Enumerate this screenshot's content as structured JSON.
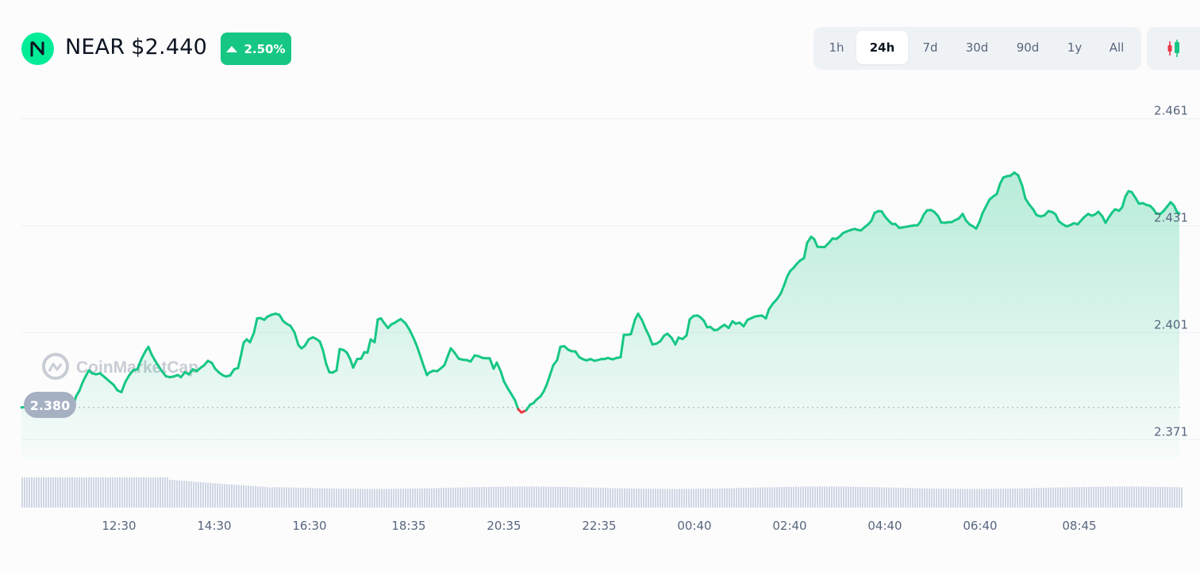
{
  "header": {
    "symbol": "NEAR",
    "price": "$2.440",
    "change": "2.50%",
    "change_direction": "up",
    "logo_icon": "near-logo-icon",
    "colors": {
      "up": "#16c784",
      "down": "#ea3943",
      "logo_bg": "#00ec97"
    }
  },
  "range_tabs": {
    "items": [
      "1h",
      "24h",
      "7d",
      "30d",
      "90d",
      "1y",
      "All"
    ],
    "active": "24h"
  },
  "candlestick_toggle": {
    "icon": "candlestick-icon"
  },
  "watermark": "CoinMarketCap",
  "chart_data": {
    "type": "area",
    "title": "",
    "xlabel": "",
    "ylabel": "",
    "reference_price": 2.38,
    "reference_label": "2.380",
    "ylim": [
      2.3655,
      2.4625
    ],
    "y_ticks": [
      "2.461",
      "2.431",
      "2.401",
      "2.371"
    ],
    "x_ticks": [
      "12:30",
      "14:30",
      "16:30",
      "18:35",
      "20:35",
      "22:35",
      "00:40",
      "02:40",
      "04:40",
      "06:40",
      "08:45"
    ],
    "xlim": [
      0,
      1464
    ],
    "x": [
      0,
      120,
      240,
      365,
      485,
      605,
      725,
      845,
      965,
      1085,
      1210
    ],
    "series_points": [
      [
        0,
        2.38
      ],
      [
        7,
        2.3802
      ],
      [
        12,
        2.3814
      ],
      [
        18,
        2.3815
      ],
      [
        22,
        2.3806
      ],
      [
        27,
        2.3804
      ],
      [
        32,
        2.3787
      ],
      [
        36,
        2.3789
      ],
      [
        41,
        2.378
      ],
      [
        47,
        2.3782
      ],
      [
        52,
        2.3775
      ],
      [
        57,
        2.3777
      ],
      [
        61,
        2.3784
      ],
      [
        65,
        2.3804
      ],
      [
        69,
        2.3832
      ],
      [
        73,
        2.3847
      ],
      [
        77,
        2.387
      ],
      [
        81,
        2.3888
      ],
      [
        85,
        2.3904
      ],
      [
        89,
        2.3896
      ],
      [
        94,
        2.3893
      ],
      [
        99,
        2.3896
      ],
      [
        105,
        2.3885
      ],
      [
        110,
        2.3875
      ],
      [
        116,
        2.3864
      ],
      [
        121,
        2.3848
      ],
      [
        126,
        2.3843
      ],
      [
        131,
        2.3872
      ],
      [
        136,
        2.3891
      ],
      [
        141,
        2.3905
      ],
      [
        146,
        2.3907
      ],
      [
        151,
        2.3935
      ],
      [
        156,
        2.3957
      ],
      [
        160,
        2.397
      ],
      [
        164,
        2.3949
      ],
      [
        168,
        2.3933
      ],
      [
        173,
        2.3915
      ],
      [
        177,
        2.3902
      ],
      [
        182,
        2.3888
      ],
      [
        187,
        2.3885
      ],
      [
        192,
        2.3887
      ],
      [
        197,
        2.3891
      ],
      [
        201,
        2.3885
      ],
      [
        206,
        2.3899
      ],
      [
        211,
        2.3893
      ],
      [
        216,
        2.3907
      ],
      [
        221,
        2.3902
      ],
      [
        226,
        2.3912
      ],
      [
        230,
        2.3918
      ],
      [
        235,
        2.3931
      ],
      [
        240,
        2.3925
      ],
      [
        244,
        2.3909
      ],
      [
        249,
        2.3898
      ],
      [
        254,
        2.389
      ],
      [
        258,
        2.3887
      ],
      [
        263,
        2.389
      ],
      [
        268,
        2.3907
      ],
      [
        273,
        2.3911
      ],
      [
        276,
        2.394
      ],
      [
        280,
        2.3982
      ],
      [
        284,
        2.3991
      ],
      [
        288,
        2.3983
      ],
      [
        293,
        2.401
      ],
      [
        297,
        2.405
      ],
      [
        301,
        2.4051
      ],
      [
        306,
        2.4046
      ],
      [
        310,
        2.4055
      ],
      [
        315,
        2.406
      ],
      [
        320,
        2.4063
      ],
      [
        325,
        2.406
      ],
      [
        330,
        2.4042
      ],
      [
        334,
        2.4035
      ],
      [
        339,
        2.4029
      ],
      [
        344,
        2.4011
      ],
      [
        349,
        2.3975
      ],
      [
        353,
        2.3966
      ],
      [
        357,
        2.3973
      ],
      [
        362,
        2.3991
      ],
      [
        367,
        2.3997
      ],
      [
        371,
        2.3993
      ],
      [
        376,
        2.3985
      ],
      [
        380,
        2.396
      ],
      [
        384,
        2.3922
      ],
      [
        388,
        2.3899
      ],
      [
        392,
        2.3898
      ],
      [
        397,
        2.3904
      ],
      [
        401,
        2.3964
      ],
      [
        406,
        2.3961
      ],
      [
        410,
        2.3954
      ],
      [
        414,
        2.3937
      ],
      [
        418,
        2.3912
      ],
      [
        423,
        2.3936
      ],
      [
        428,
        2.3937
      ],
      [
        432,
        2.3955
      ],
      [
        436,
        2.3954
      ],
      [
        440,
        2.3991
      ],
      [
        445,
        2.3983
      ],
      [
        449,
        2.4047
      ],
      [
        453,
        2.405
      ],
      [
        457,
        2.4037
      ],
      [
        462,
        2.4023
      ],
      [
        466,
        2.4033
      ],
      [
        470,
        2.4037
      ],
      [
        474,
        2.4043
      ],
      [
        478,
        2.4048
      ],
      [
        484,
        2.4036
      ],
      [
        489,
        2.4018
      ],
      [
        494,
        2.3995
      ],
      [
        498,
        2.3974
      ],
      [
        503,
        2.3942
      ],
      [
        507,
        2.3915
      ],
      [
        511,
        2.3891
      ],
      [
        514,
        2.3898
      ],
      [
        519,
        2.3903
      ],
      [
        524,
        2.3902
      ],
      [
        528,
        2.3909
      ],
      [
        533,
        2.3919
      ],
      [
        537,
        2.3943
      ],
      [
        541,
        2.3966
      ],
      [
        546,
        2.3953
      ],
      [
        551,
        2.3937
      ],
      [
        556,
        2.3934
      ],
      [
        561,
        2.3933
      ],
      [
        566,
        2.3929
      ],
      [
        571,
        2.3946
      ],
      [
        576,
        2.3944
      ],
      [
        581,
        2.3939
      ],
      [
        586,
        2.3938
      ],
      [
        590,
        2.3938
      ],
      [
        595,
        2.3909
      ],
      [
        599,
        2.3926
      ],
      [
        604,
        2.3901
      ],
      [
        608,
        2.3873
      ],
      [
        613,
        2.3853
      ],
      [
        618,
        2.3835
      ],
      [
        622,
        2.382
      ],
      [
        626,
        2.3795
      ],
      [
        630,
        2.3786
      ],
      [
        636,
        2.3792
      ],
      [
        641,
        2.3808
      ],
      [
        645,
        2.3812
      ],
      [
        649,
        2.3822
      ],
      [
        654,
        2.3831
      ],
      [
        658,
        2.3845
      ],
      [
        662,
        2.3865
      ],
      [
        666,
        2.3891
      ],
      [
        670,
        2.3918
      ],
      [
        675,
        2.3933
      ],
      [
        679,
        2.397
      ],
      [
        684,
        2.3972
      ],
      [
        689,
        2.3962
      ],
      [
        693,
        2.3958
      ],
      [
        698,
        2.3957
      ],
      [
        703,
        2.3941
      ],
      [
        707,
        2.3936
      ],
      [
        712,
        2.3932
      ],
      [
        717,
        2.3936
      ],
      [
        722,
        2.3931
      ],
      [
        726,
        2.3933
      ],
      [
        731,
        2.3936
      ],
      [
        735,
        2.3936
      ],
      [
        739,
        2.3939
      ],
      [
        745,
        2.3935
      ],
      [
        750,
        2.3939
      ],
      [
        755,
        2.3941
      ],
      [
        759,
        2.4004
      ],
      [
        764,
        2.4004
      ],
      [
        768,
        2.4006
      ],
      [
        773,
        2.4046
      ],
      [
        777,
        2.4063
      ],
      [
        782,
        2.4045
      ],
      [
        786,
        2.4023
      ],
      [
        791,
        2.4
      ],
      [
        795,
        2.3977
      ],
      [
        800,
        2.3979
      ],
      [
        805,
        2.3986
      ],
      [
        810,
        2.4002
      ],
      [
        814,
        2.4007
      ],
      [
        819,
        2.3996
      ],
      [
        824,
        2.3977
      ],
      [
        828,
        2.3996
      ],
      [
        833,
        2.3992
      ],
      [
        838,
        2.4002
      ],
      [
        842,
        2.4047
      ],
      [
        847,
        2.4057
      ],
      [
        852,
        2.4058
      ],
      [
        856,
        2.4052
      ],
      [
        860,
        2.4043
      ],
      [
        864,
        2.4025
      ],
      [
        868,
        2.4026
      ],
      [
        873,
        2.4017
      ],
      [
        877,
        2.4018
      ],
      [
        881,
        2.4025
      ],
      [
        886,
        2.4032
      ],
      [
        891,
        2.4023
      ],
      [
        896,
        2.4042
      ],
      [
        900,
        2.4035
      ],
      [
        905,
        2.4038
      ],
      [
        910,
        2.4028
      ],
      [
        915,
        2.4046
      ],
      [
        919,
        2.405
      ],
      [
        924,
        2.4055
      ],
      [
        929,
        2.4057
      ],
      [
        933,
        2.4058
      ],
      [
        938,
        2.405
      ],
      [
        942,
        2.4076
      ],
      [
        947,
        2.4092
      ],
      [
        952,
        2.4104
      ],
      [
        957,
        2.4121
      ],
      [
        961,
        2.4143
      ],
      [
        965,
        2.4168
      ],
      [
        969,
        2.4184
      ],
      [
        973,
        2.4192
      ],
      [
        977,
        2.4203
      ],
      [
        981,
        2.4212
      ],
      [
        986,
        2.4219
      ],
      [
        990,
        2.4262
      ],
      [
        995,
        2.4279
      ],
      [
        999,
        2.4272
      ],
      [
        1003,
        2.4251
      ],
      [
        1008,
        2.425
      ],
      [
        1012,
        2.425
      ],
      [
        1017,
        2.4261
      ],
      [
        1022,
        2.4274
      ],
      [
        1027,
        2.4273
      ],
      [
        1031,
        2.428
      ],
      [
        1035,
        2.4289
      ],
      [
        1040,
        2.4294
      ],
      [
        1045,
        2.4298
      ],
      [
        1050,
        2.4301
      ],
      [
        1054,
        2.4298
      ],
      [
        1058,
        2.4297
      ],
      [
        1063,
        2.4307
      ],
      [
        1067,
        2.4314
      ],
      [
        1071,
        2.4324
      ],
      [
        1075,
        2.4346
      ],
      [
        1080,
        2.4351
      ],
      [
        1084,
        2.435
      ],
      [
        1088,
        2.4336
      ],
      [
        1093,
        2.4323
      ],
      [
        1097,
        2.4315
      ],
      [
        1101,
        2.4315
      ],
      [
        1106,
        2.4304
      ],
      [
        1110,
        2.4305
      ],
      [
        1115,
        2.4307
      ],
      [
        1120,
        2.4309
      ],
      [
        1125,
        2.4311
      ],
      [
        1129,
        2.4311
      ],
      [
        1133,
        2.4322
      ],
      [
        1137,
        2.4341
      ],
      [
        1141,
        2.4353
      ],
      [
        1146,
        2.4354
      ],
      [
        1150,
        2.4349
      ],
      [
        1155,
        2.4337
      ],
      [
        1159,
        2.4319
      ],
      [
        1163,
        2.4318
      ],
      [
        1168,
        2.432
      ],
      [
        1172,
        2.432
      ],
      [
        1176,
        2.4325
      ],
      [
        1181,
        2.433
      ],
      [
        1186,
        2.4343
      ],
      [
        1190,
        2.4325
      ],
      [
        1195,
        2.4313
      ],
      [
        1199,
        2.4308
      ],
      [
        1203,
        2.4302
      ],
      [
        1207,
        2.432
      ],
      [
        1211,
        2.4345
      ],
      [
        1216,
        2.4367
      ],
      [
        1220,
        2.4384
      ],
      [
        1225,
        2.4393
      ],
      [
        1229,
        2.4399
      ],
      [
        1233,
        2.4427
      ],
      [
        1237,
        2.4445
      ],
      [
        1242,
        2.4449
      ],
      [
        1246,
        2.445
      ],
      [
        1251,
        2.4459
      ],
      [
        1256,
        2.4451
      ],
      [
        1261,
        2.4422
      ],
      [
        1265,
        2.4386
      ],
      [
        1270,
        2.4369
      ],
      [
        1275,
        2.4355
      ],
      [
        1279,
        2.434
      ],
      [
        1284,
        2.4336
      ],
      [
        1289,
        2.4339
      ],
      [
        1294,
        2.4351
      ],
      [
        1299,
        2.4348
      ],
      [
        1303,
        2.4342
      ],
      [
        1307,
        2.4323
      ],
      [
        1312,
        2.4314
      ],
      [
        1317,
        2.4308
      ],
      [
        1322,
        2.4312
      ],
      [
        1326,
        2.4317
      ],
      [
        1331,
        2.4314
      ],
      [
        1335,
        2.4324
      ],
      [
        1339,
        2.4334
      ],
      [
        1344,
        2.4343
      ],
      [
        1349,
        2.4338
      ],
      [
        1353,
        2.4342
      ],
      [
        1357,
        2.4349
      ],
      [
        1362,
        2.4336
      ],
      [
        1366,
        2.4318
      ],
      [
        1370,
        2.4333
      ],
      [
        1374,
        2.4346
      ],
      [
        1378,
        2.4356
      ],
      [
        1383,
        2.4352
      ],
      [
        1387,
        2.4362
      ],
      [
        1391,
        2.4392
      ],
      [
        1395,
        2.4407
      ],
      [
        1399,
        2.4404
      ],
      [
        1404,
        2.4387
      ],
      [
        1408,
        2.4372
      ],
      [
        1413,
        2.4373
      ],
      [
        1418,
        2.4368
      ],
      [
        1422,
        2.4366
      ],
      [
        1426,
        2.4357
      ],
      [
        1430,
        2.4344
      ],
      [
        1435,
        2.4343
      ],
      [
        1439,
        2.4351
      ],
      [
        1443,
        2.4362
      ],
      [
        1448,
        2.4376
      ],
      [
        1452,
        2.4367
      ],
      [
        1456,
        2.4349
      ],
      [
        1459,
        2.4344
      ]
    ],
    "grid": true,
    "volume_bars": true
  }
}
